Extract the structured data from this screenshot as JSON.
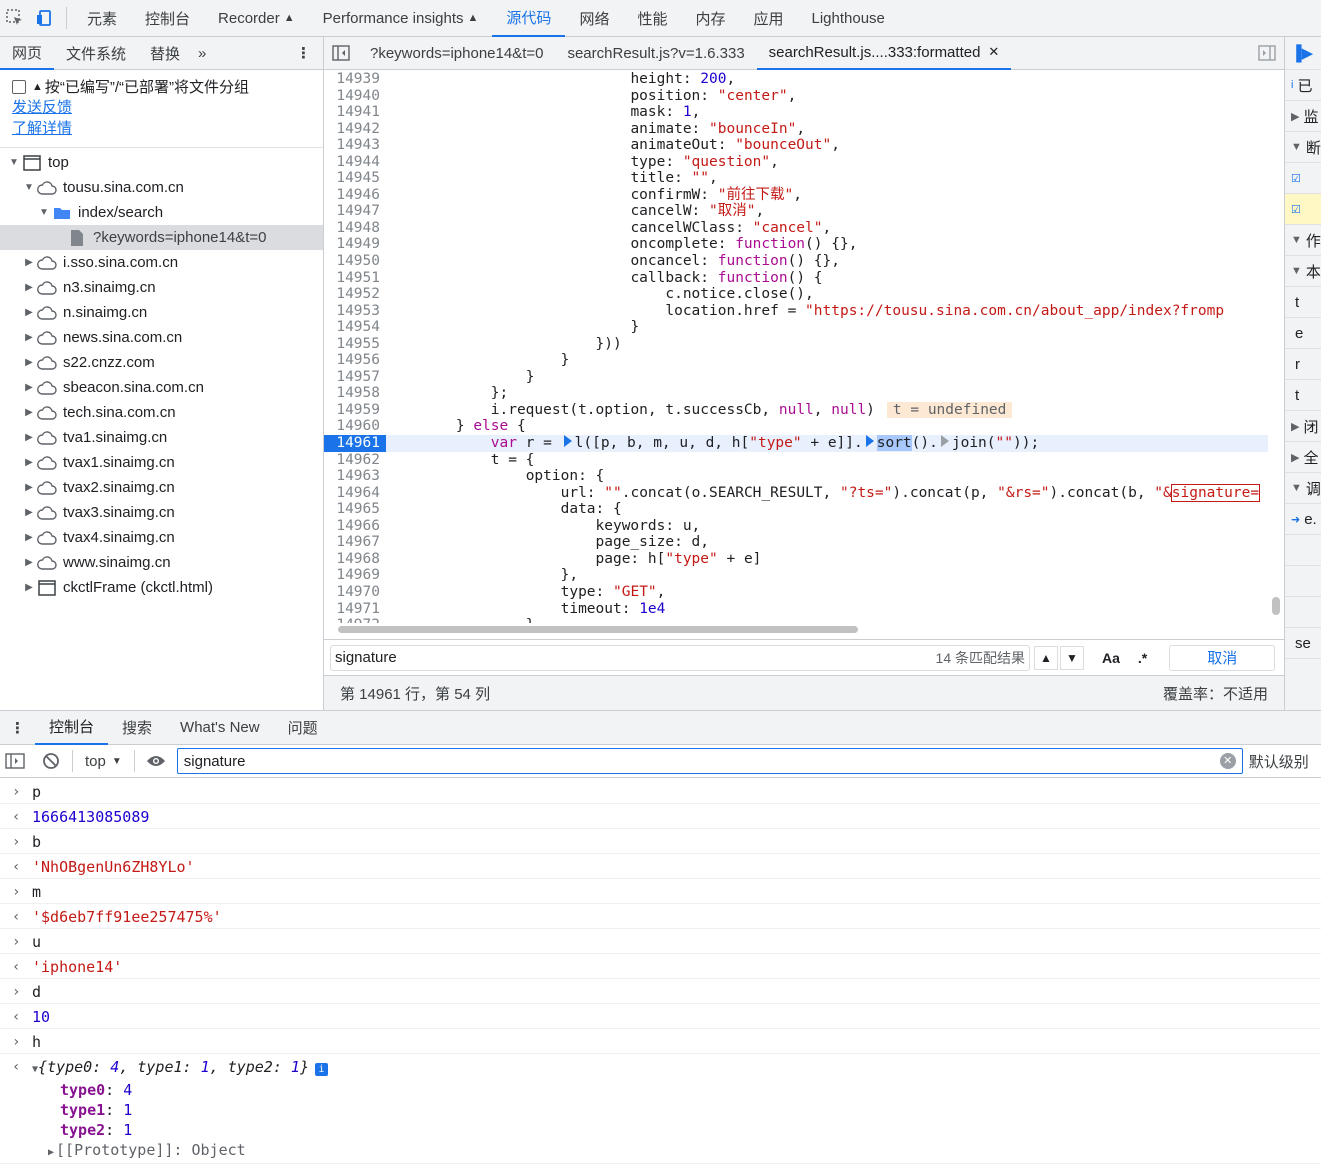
{
  "topbar": {
    "tabs": [
      "元素",
      "控制台",
      "Recorder",
      "Performance insights",
      "源代码",
      "网络",
      "性能",
      "内存",
      "应用",
      "Lighthouse"
    ],
    "active": "源代码"
  },
  "navigator": {
    "tabs": [
      "网页",
      "文件系统",
      "替换"
    ],
    "group_label": "按“已编写”/“已部署”将文件分组",
    "feedback_link": "发送反馈",
    "learn_link": "了解详情",
    "tree": [
      {
        "label": "top",
        "type": "frame",
        "depth": 0,
        "expanded": true
      },
      {
        "label": "tousu.sina.com.cn",
        "type": "cloud",
        "depth": 1,
        "expanded": true
      },
      {
        "label": "index/search",
        "type": "folder",
        "depth": 2,
        "expanded": true
      },
      {
        "label": "?keywords=iphone14&t=0",
        "type": "file",
        "depth": 3,
        "selected": true
      },
      {
        "label": "i.sso.sina.com.cn",
        "type": "cloud",
        "depth": 1
      },
      {
        "label": "n3.sinaimg.cn",
        "type": "cloud",
        "depth": 1
      },
      {
        "label": "n.sinaimg.cn",
        "type": "cloud",
        "depth": 1
      },
      {
        "label": "news.sina.com.cn",
        "type": "cloud",
        "depth": 1
      },
      {
        "label": "s22.cnzz.com",
        "type": "cloud",
        "depth": 1
      },
      {
        "label": "sbeacon.sina.com.cn",
        "type": "cloud",
        "depth": 1
      },
      {
        "label": "tech.sina.com.cn",
        "type": "cloud",
        "depth": 1
      },
      {
        "label": "tva1.sinaimg.cn",
        "type": "cloud",
        "depth": 1
      },
      {
        "label": "tvax1.sinaimg.cn",
        "type": "cloud",
        "depth": 1
      },
      {
        "label": "tvax2.sinaimg.cn",
        "type": "cloud",
        "depth": 1
      },
      {
        "label": "tvax3.sinaimg.cn",
        "type": "cloud",
        "depth": 1
      },
      {
        "label": "tvax4.sinaimg.cn",
        "type": "cloud",
        "depth": 1
      },
      {
        "label": "www.sinaimg.cn",
        "type": "cloud",
        "depth": 1
      },
      {
        "label": "ckctlFrame (ckctl.html)",
        "type": "frame",
        "depth": 1
      }
    ]
  },
  "editor": {
    "tabs": [
      "?keywords=iphone14&t=0",
      "searchResult.js?v=1.6.333",
      "searchResult.js....333:formatted"
    ],
    "active_tab": 2,
    "current_line": 14961,
    "search": {
      "query": "signature",
      "count": "14 条匹配结果",
      "case_label": "Aa",
      "regex_label": ".*",
      "cancel": "取消"
    },
    "status": {
      "position": "第 14961 行，第 54 列",
      "coverage": "覆盖率：不适用"
    }
  },
  "debugger_strip": {
    "rows": [
      "已",
      "监",
      "断",
      "",
      "",
      "作",
      "本",
      "t",
      "e",
      "r",
      "t",
      "闭",
      "全",
      "调",
      "e.",
      "",
      "",
      "",
      "se"
    ]
  },
  "drawer": {
    "tabs": [
      "控制台",
      "搜索",
      "What's New",
      "问题"
    ],
    "active": "控制台",
    "context": "top",
    "filter": "signature",
    "levels": "默认级别"
  },
  "console": {
    "entries": [
      {
        "input": "p",
        "output": "1666413085089",
        "kind": "num"
      },
      {
        "input": "b",
        "output": "'NhOBgenUn6ZH8YLo'",
        "kind": "str"
      },
      {
        "input": "m",
        "output": "'$d6eb7ff91ee257475%'",
        "kind": "str"
      },
      {
        "input": "u",
        "output": "'iphone14'",
        "kind": "str"
      },
      {
        "input": "d",
        "output": "10",
        "kind": "num"
      }
    ],
    "object_entry": {
      "input": "h",
      "summary": "{type0: 4, type1: 1, type2: 1}",
      "props": [
        {
          "key": "type0",
          "val": "4"
        },
        {
          "key": "type1",
          "val": "1"
        },
        {
          "key": "type2",
          "val": "1"
        }
      ],
      "prototype": "[[Prototype]]: Object"
    },
    "trailing": "}"
  },
  "colors": {
    "accent": "#1a73e8",
    "keyword": "#aa0d91",
    "string": "#c41a16",
    "number": "#1c00cf"
  }
}
